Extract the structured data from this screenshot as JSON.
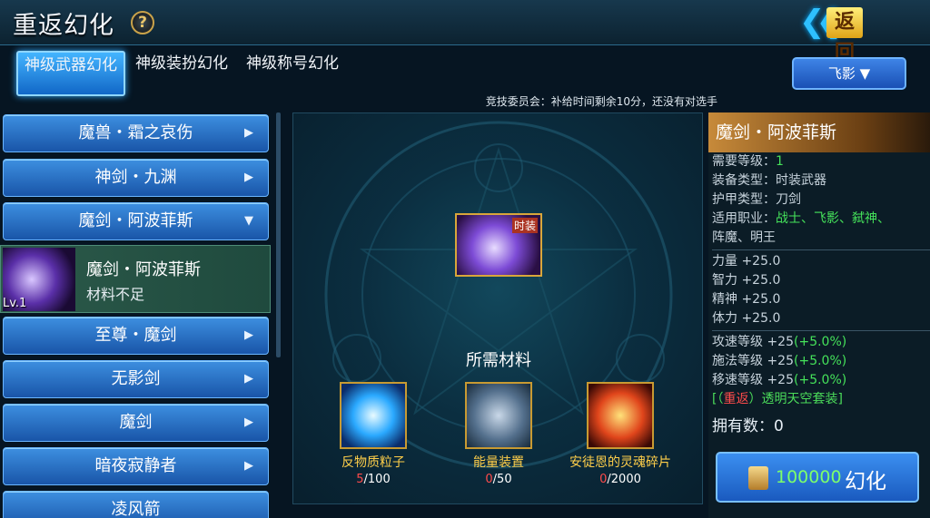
{
  "header": {
    "title": "重返幻化",
    "help_label": "?",
    "back_label": "返回",
    "back_chevron": "❮❮"
  },
  "tabs": [
    {
      "label": "神级武器幻化",
      "active": true
    },
    {
      "label": "神级装扮幻化",
      "active": false
    },
    {
      "label": "神级称号幻化",
      "active": false
    }
  ],
  "class_dropdown": {
    "selected": "飞影",
    "caret": "▼"
  },
  "ticker": "竞技委员会：补给时间剩余10分，还没有对选手",
  "list": {
    "items": [
      {
        "label": "魔兽・霜之哀伤",
        "arrow": "▶"
      },
      {
        "label": "神剑・九渊",
        "arrow": "▶"
      },
      {
        "label": "魔剑・阿波菲斯",
        "arrow": "▼"
      },
      {
        "label": "至尊・魔剑",
        "arrow": "▶"
      },
      {
        "label": "无影剑",
        "arrow": "▶"
      },
      {
        "label": "魔剑",
        "arrow": "▶"
      },
      {
        "label": "暗夜寂静者",
        "arrow": "▶"
      },
      {
        "label": "凌风箭",
        "arrow": ""
      }
    ],
    "selected": {
      "name": "魔剑・阿波菲斯",
      "status": "材料不足",
      "level": "Lv.1"
    }
  },
  "center": {
    "item_badge": "时装",
    "materials_title": "所需材料",
    "materials": [
      {
        "name": "反物质粒子",
        "have": "5",
        "need": "/100",
        "icon": "crystal-shard-icon"
      },
      {
        "name": "能量装置",
        "have": "0",
        "need": "/50",
        "icon": "energy-canister-icon"
      },
      {
        "name": "安徒恩的灵魂碎片",
        "have": "0",
        "need": "/2000",
        "icon": "soul-fragment-icon"
      }
    ]
  },
  "detail": {
    "name": "魔剑・阿波菲斯",
    "req_level_label": "需要等级：",
    "req_level": "1",
    "equip_type_label": "装备类型：",
    "equip_type": "时装武器",
    "armor_type_label": "护甲类型：",
    "armor_type": "刀剑",
    "classes_label": "适用职业：",
    "classes_1": "战士、飞影、弑神、",
    "classes_2": "阵魔、明王",
    "stats": [
      "力量 +25.0",
      "智力 +25.0",
      "精神 +25.0",
      "体力 +25.0"
    ],
    "bonus": [
      {
        "base": "攻速等级 +25",
        "pct": "(+5.0%)"
      },
      {
        "base": "施法等级 +25",
        "pct": "(+5.0%)"
      },
      {
        "base": "移速等级 +25",
        "pct": "(+5.0%)"
      }
    ],
    "set_prefix": "[（",
    "set_tag": "重返",
    "set_suffix": "）透明天空套装]",
    "owned_label": "拥有数：",
    "owned": "0",
    "cost": "100000",
    "action_label": "幻化"
  },
  "colors": {
    "accent": "#2e8ff0",
    "gold": "#d9a63a",
    "green": "#45e25a",
    "red": "#ff4b4b"
  }
}
